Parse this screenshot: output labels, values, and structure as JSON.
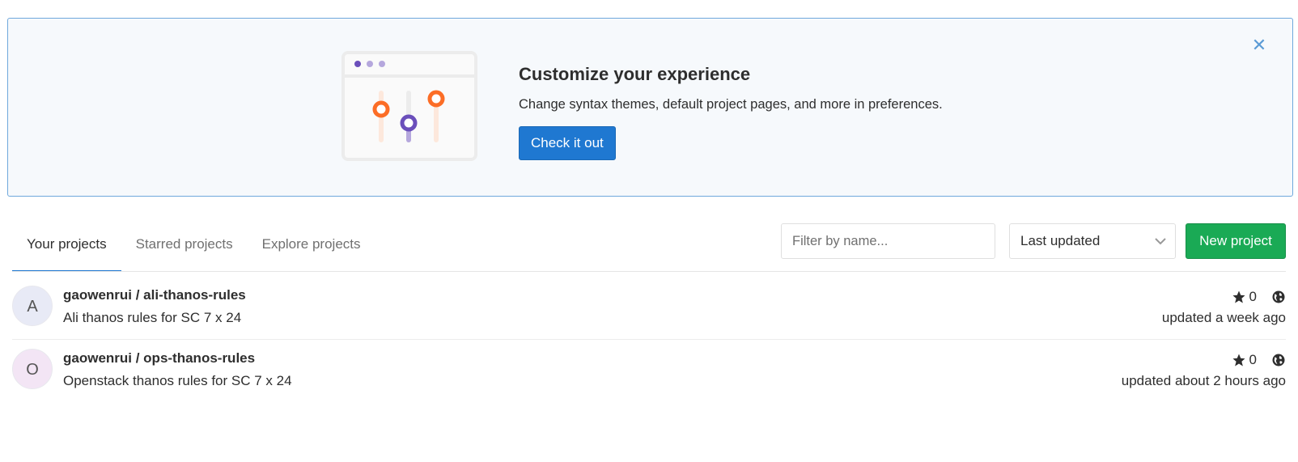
{
  "banner": {
    "title": "Customize your experience",
    "description": "Change syntax themes, default project pages, and more in preferences.",
    "cta_label": "Check it out",
    "close_icon": "close-icon"
  },
  "tabs": [
    {
      "label": "Your projects",
      "active": true
    },
    {
      "label": "Starred projects",
      "active": false
    },
    {
      "label": "Explore projects",
      "active": false
    }
  ],
  "filter": {
    "placeholder": "Filter by name..."
  },
  "sort": {
    "selected": "Last updated"
  },
  "new_project_label": "New project",
  "projects": [
    {
      "avatar_letter": "A",
      "name": "gaowenrui / ali-thanos-rules",
      "description": "Ali thanos rules for SC 7 x 24",
      "stars": "0",
      "updated": "updated a week ago",
      "visibility_icon": "globe-icon"
    },
    {
      "avatar_letter": "O",
      "name": "gaowenrui / ops-thanos-rules",
      "description": "Openstack thanos rules for SC 7 x 24",
      "stars": "0",
      "updated": "updated about 2 hours ago",
      "visibility_icon": "globe-icon"
    }
  ],
  "colors": {
    "accent_blue": "#1f78d1",
    "accent_green": "#1aaa55",
    "illustration_orange": "#fc6d26",
    "illustration_purple": "#6b4fbb"
  }
}
